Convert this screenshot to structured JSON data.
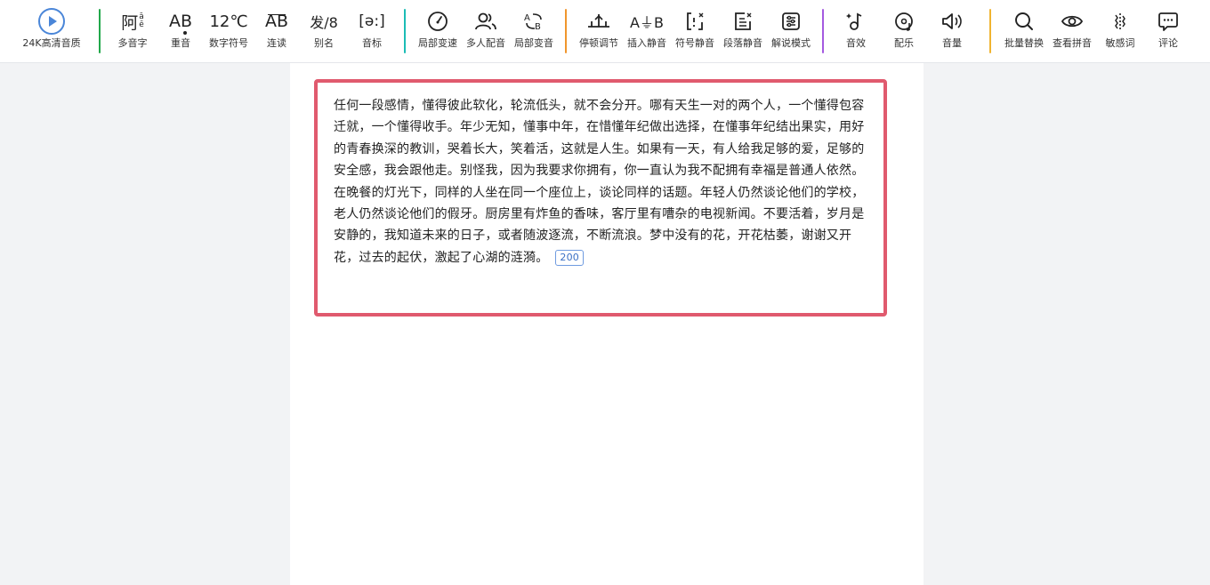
{
  "toolbar": {
    "groups": [
      [
        {
          "label": "24K高清音质"
        }
      ],
      [
        {
          "label": "多音字",
          "glyph": "阿",
          "sup": "ā",
          "sub": "ē"
        },
        {
          "label": "重音",
          "glyph": "AB"
        },
        {
          "label": "数字符号",
          "glyph": "12℃"
        },
        {
          "label": "连读",
          "glyph": "AB"
        },
        {
          "label": "别名",
          "glyph": "发/8"
        },
        {
          "label": "音标",
          "glyph": "[ə:]"
        }
      ],
      [
        {
          "label": "局部变速"
        },
        {
          "label": "多人配音"
        },
        {
          "label": "局部变音"
        }
      ],
      [
        {
          "label": "停顿调节"
        },
        {
          "label": "插入静音",
          "glyph": "A⏚B"
        },
        {
          "label": "符号静音"
        },
        {
          "label": "段落静音"
        },
        {
          "label": "解说模式"
        }
      ],
      [
        {
          "label": "音效"
        },
        {
          "label": "配乐"
        },
        {
          "label": "音量"
        }
      ],
      [
        {
          "label": "批量替换"
        },
        {
          "label": "查看拼音"
        },
        {
          "label": "敏感词"
        },
        {
          "label": "评论"
        }
      ]
    ],
    "separator_colors": [
      "#22a84a",
      "#1bbcb5",
      "#f0962d",
      "#a45ae0",
      "#f0b430"
    ]
  },
  "editor": {
    "text": "任何一段感情，懂得彼此软化，轮流低头，就不会分开。哪有天生一对的两个人，一个懂得包容迁就，一个懂得收手。年少无知，懂事中年，在惜懂年纪做出选择，在懂事年纪结出果实，用好的青春换深的教训，哭着长大，笑着活，这就是人生。如果有一天，有人给我足够的爱，足够的安全感，我会跟他走。别怪我，因为我要求你拥有，你一直认为我不配拥有幸福是普通人依然。在晚餐的灯光下，同样的人坐在同一个座位上，谈论同样的话题。年轻人仍然谈论他们的学校，老人仍然谈论他们的假牙。厨房里有炸鱼的香味，客厅里有嘈杂的电视新闻。不要活着，岁月是安静的，我知道未来的日子，或者随波逐流，不断流浪。梦中没有的花，开花枯萎，谢谢又开花，过去的起伏，激起了心湖的涟漪。",
    "char_count": "200",
    "border_color": "#e05a6e"
  }
}
